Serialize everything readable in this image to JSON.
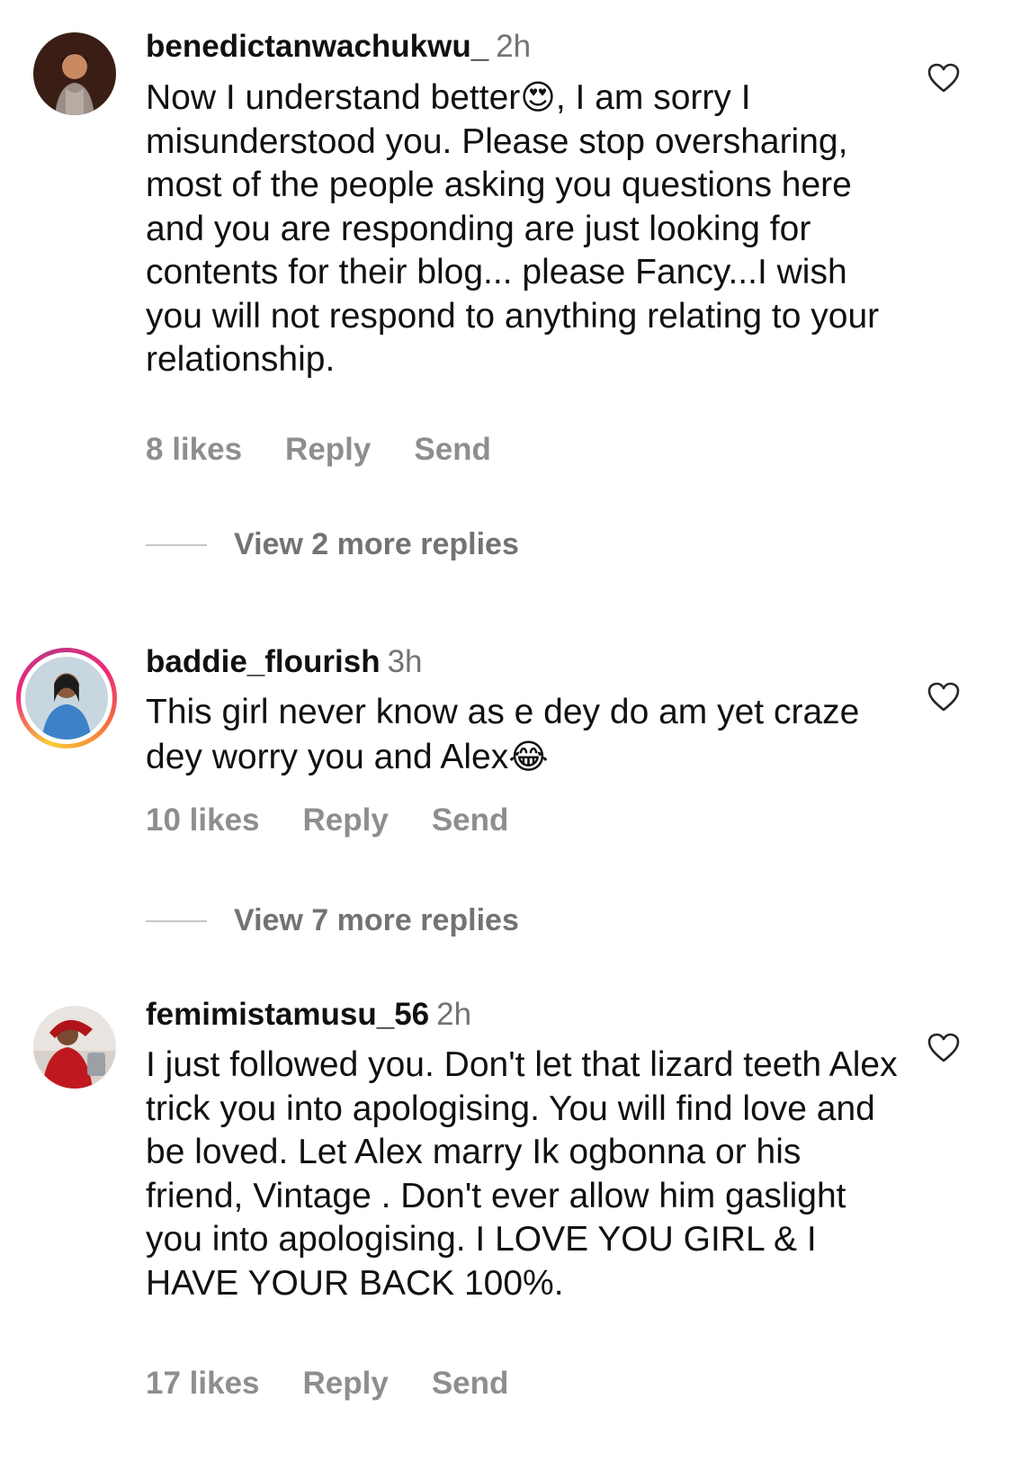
{
  "comments": [
    {
      "username": "benedictanwachukwu_",
      "time": "2h",
      "text_parts": [
        "Now I understand better",
        "😍",
        ", I am sorry I misunderstood you. Please stop oversharing, most of the people asking you questions here and you are responding are just looking for contents for their blog... please Fancy...I wish you will not respond to anything relating to your relationship."
      ],
      "likes": "8 likes",
      "reply": "Reply",
      "send": "Send",
      "view_more": "View 2 more replies"
    },
    {
      "username": "baddie_flourish",
      "time": "3h",
      "text_parts": [
        "This girl never know as e dey do am yet craze dey worry you and Alex",
        "😂"
      ],
      "likes": "10 likes",
      "reply": "Reply",
      "send": "Send",
      "view_more": "View 7 more replies"
    },
    {
      "username": "femimistamusu_56",
      "time": "2h",
      "text": "I just followed you.  Don't let that lizard teeth Alex trick you into apologising.  You will find love and be loved.  Let Alex marry Ik ogbonna or his friend, Vintage . Don't ever allow him gaslight you into apologising.  I LOVE YOU GIRL & I HAVE YOUR BACK 100%.",
      "likes": "17 likes",
      "reply": "Reply",
      "send": "Send"
    }
  ],
  "icons": {
    "like": "heart-outline-icon",
    "story_ring": "story-ring"
  },
  "colors": {
    "text": "#111111",
    "secondary": "#737373",
    "actions": "#8e8e8e",
    "divider": "#c7c7c7"
  }
}
